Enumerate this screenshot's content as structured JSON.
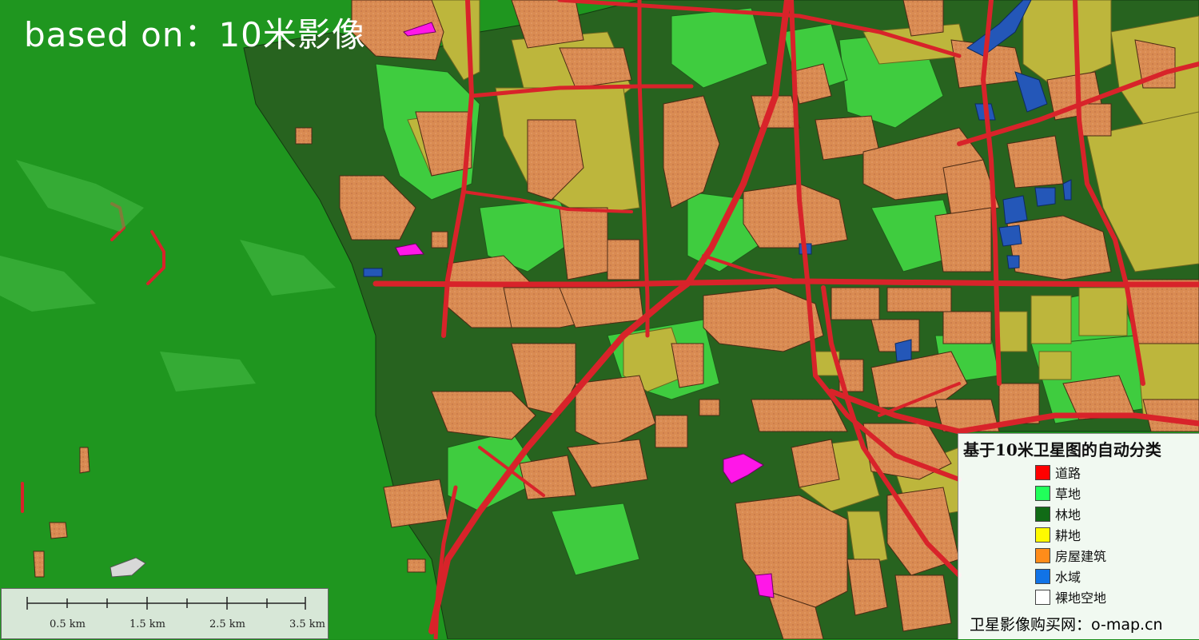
{
  "map_title": "based on：10米影像",
  "colors": {
    "forest_bg": "#1f961f",
    "dark_forest": "#27631f",
    "grass": "#3fcc3f",
    "road": "#d8232a",
    "building": "#d98b52",
    "cropland": "#bdb63c",
    "water": "#2457b8",
    "bare": "#ff17e8"
  },
  "legend": {
    "title": "基于10米卫星图的自动分类",
    "items": [
      {
        "label": "道路",
        "color": "#ff0000"
      },
      {
        "label": "草地",
        "color": "#21ff5a"
      },
      {
        "label": "林地",
        "color": "#116b16"
      },
      {
        "label": "耕地",
        "color": "#fffa00"
      },
      {
        "label": "房屋建筑",
        "color": "#ff8c1a"
      },
      {
        "label": "水域",
        "color": "#1173e6"
      },
      {
        "label": "裸地空地",
        "color": "#ffffff"
      }
    ],
    "footer": "卫星影像购买网：o-map.cn"
  },
  "scale_bar": {
    "labels": [
      "0.5 km",
      "1.5 km",
      "2.5 km",
      "3.5 km"
    ]
  }
}
